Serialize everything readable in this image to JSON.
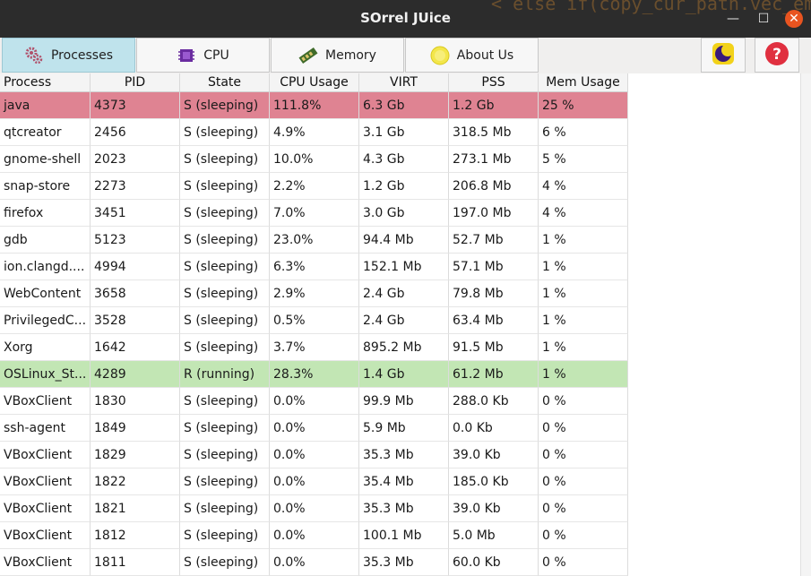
{
  "window": {
    "title": "SOrrel JUice",
    "background_code": "< else if(copy_cur_path.vec_empt",
    "controls": {
      "minimize": "—",
      "maximize": "☐",
      "close": "✕"
    }
  },
  "tabs": [
    {
      "label": "Processes",
      "icon": "processes-gears-icon",
      "active": true
    },
    {
      "label": "CPU",
      "icon": "cpu-chip-icon",
      "active": false
    },
    {
      "label": "Memory",
      "icon": "memory-ram-icon",
      "active": false
    },
    {
      "label": "About Us",
      "icon": "about-us-smiley-icon",
      "active": false
    }
  ],
  "toolbar_buttons": [
    {
      "name": "theme-toggle",
      "icon": "moon-icon"
    },
    {
      "name": "help",
      "icon": "question-mark-icon"
    }
  ],
  "colors": {
    "accent_tab": "#bfe3ec",
    "highlight_high_usage": "#df8392",
    "highlight_running": "#c2e6b4",
    "close_button": "#e95420"
  },
  "table": {
    "columns": [
      "Process name",
      "PID",
      "State",
      "CPU Usage",
      "VIRT",
      "PSS",
      "Mem Usage"
    ],
    "rows": [
      [
        "java",
        "4373",
        "S (sleeping)",
        "111.8%",
        "6.3 Gb",
        "1.2 Gb",
        "25 %"
      ],
      [
        "qtcreator",
        "2456",
        "S (sleeping)",
        "4.9%",
        "3.1 Gb",
        "318.5 Mb",
        "6 %"
      ],
      [
        "gnome-shell",
        "2023",
        "S (sleeping)",
        "10.0%",
        "4.3 Gb",
        "273.1 Mb",
        "5 %"
      ],
      [
        "snap-store",
        "2273",
        "S (sleeping)",
        "2.2%",
        "1.2 Gb",
        "206.8 Mb",
        "4 %"
      ],
      [
        "firefox",
        "3451",
        "S (sleeping)",
        "7.0%",
        "3.0 Gb",
        "197.0 Mb",
        "4 %"
      ],
      [
        "gdb",
        "5123",
        "S (sleeping)",
        "23.0%",
        "94.4 Mb",
        "52.7 Mb",
        "1 %"
      ],
      [
        "ion.clangd....",
        "4994",
        "S (sleeping)",
        "6.3%",
        "152.1 Mb",
        "57.1 Mb",
        "1 %"
      ],
      [
        "WebContent",
        "3658",
        "S (sleeping)",
        "2.9%",
        "2.4 Gb",
        "79.8 Mb",
        "1 %"
      ],
      [
        "PrivilegedC...",
        "3528",
        "S (sleeping)",
        "0.5%",
        "2.4 Gb",
        "63.4 Mb",
        "1 %"
      ],
      [
        "Xorg",
        "1642",
        "S (sleeping)",
        "3.7%",
        "895.2 Mb",
        "91.5 Mb",
        "1 %"
      ],
      [
        "OSLinux_St...",
        "4289",
        "R (running)",
        "28.3%",
        "1.4 Gb",
        "61.2 Mb",
        "1 %"
      ],
      [
        "VBoxClient",
        "1830",
        "S (sleeping)",
        "0.0%",
        "99.9 Mb",
        "288.0 Kb",
        "0 %"
      ],
      [
        "ssh-agent",
        "1849",
        "S (sleeping)",
        "0.0%",
        "5.9 Mb",
        "0.0 Kb",
        "0 %"
      ],
      [
        "VBoxClient",
        "1829",
        "S (sleeping)",
        "0.0%",
        "35.3 Mb",
        "39.0 Kb",
        "0 %"
      ],
      [
        "VBoxClient",
        "1822",
        "S (sleeping)",
        "0.0%",
        "35.4 Mb",
        "185.0 Kb",
        "0 %"
      ],
      [
        "VBoxClient",
        "1821",
        "S (sleeping)",
        "0.0%",
        "35.3 Mb",
        "39.0 Kb",
        "0 %"
      ],
      [
        "VBoxClient",
        "1812",
        "S (sleeping)",
        "0.0%",
        "100.1 Mb",
        "5.0 Mb",
        "0 %"
      ],
      [
        "VBoxClient",
        "1811",
        "S (sleeping)",
        "0.0%",
        "35.3 Mb",
        "60.0 Kb",
        "0 %"
      ]
    ],
    "highlight": {
      "0": "high-usage",
      "10": "running"
    }
  }
}
